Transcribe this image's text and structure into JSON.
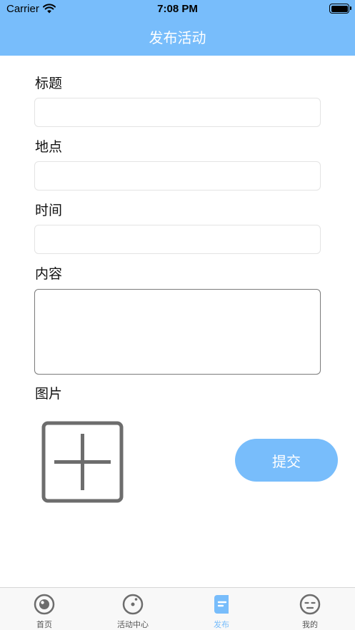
{
  "status_bar": {
    "carrier": "Carrier",
    "time": "7:08 PM"
  },
  "nav": {
    "title": "发布活动"
  },
  "form": {
    "title_label": "标题",
    "title_value": "",
    "location_label": "地点",
    "location_value": "",
    "time_label": "时间",
    "time_value": "",
    "content_label": "内容",
    "content_value": "",
    "images_label": "图片"
  },
  "submit_label": "提交",
  "tabs": [
    {
      "label": "首页",
      "icon": "home-icon",
      "active": false
    },
    {
      "label": "活动中心",
      "icon": "compass-icon",
      "active": false
    },
    {
      "label": "发布",
      "icon": "publish-icon",
      "active": true
    },
    {
      "label": "我的",
      "icon": "profile-icon",
      "active": false
    }
  ],
  "colors": {
    "accent": "#78bdfb",
    "tab_inactive": "#555555",
    "icon_gray": "#6d6d6d"
  }
}
